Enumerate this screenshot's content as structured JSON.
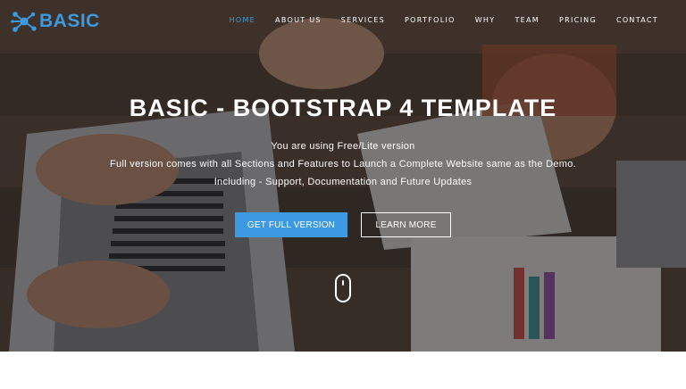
{
  "brand": {
    "name": "BASIC",
    "color": "#3b9ae1",
    "icon": "molecule-icon"
  },
  "nav": {
    "items": [
      {
        "label": "HOME",
        "active": true
      },
      {
        "label": "ABOUT US"
      },
      {
        "label": "SERVICES"
      },
      {
        "label": "PORTFOLIO"
      },
      {
        "label": "WHY"
      },
      {
        "label": "TEAM"
      },
      {
        "label": "PRICING"
      },
      {
        "label": "CONTACT"
      }
    ]
  },
  "hero": {
    "title": "BASIC - BOOTSTRAP 4 TEMPLATE",
    "line1": "You are using Free/Lite version",
    "line2": "Full version comes with all Sections and Features to Launch a Complete Website same as the Demo.",
    "line3": "Including - Support, Documentation and Future Updates",
    "primary_button": "GET FULL VERSION",
    "secondary_button": "LEARN MORE",
    "scroll_icon": "mouse-scroll-icon"
  },
  "colors": {
    "accent": "#3b9ae1",
    "overlay": "#141212",
    "footer_bg": "#ffffff"
  }
}
